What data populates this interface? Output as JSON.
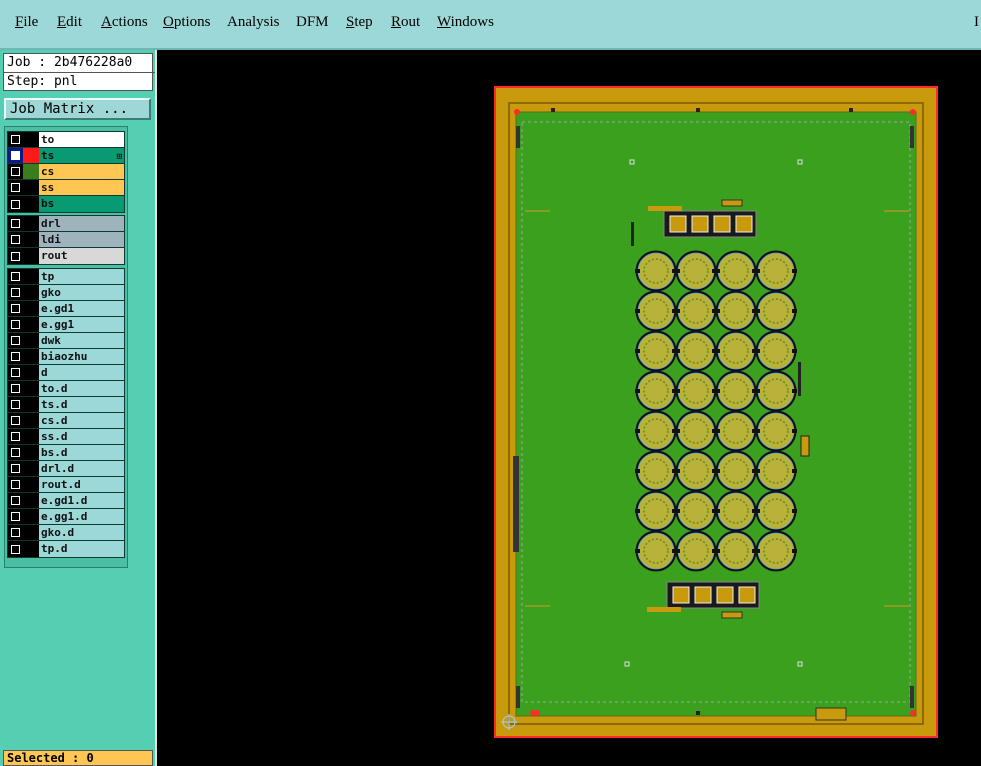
{
  "menubar": {
    "items": [
      {
        "label": "File",
        "key": "F",
        "rest": "ile"
      },
      {
        "label": "Edit",
        "key": "E",
        "rest": "dit"
      },
      {
        "label": "Actions",
        "key": "A",
        "rest": "ctions"
      },
      {
        "label": "Options",
        "key": "O",
        "rest": "ptions"
      },
      {
        "label": "Analysis",
        "key": "",
        "rest": "Analysis"
      },
      {
        "label": "DFM",
        "key": "",
        "rest": "DFM"
      },
      {
        "label": "Step",
        "key": "S",
        "rest": "tep"
      },
      {
        "label": "Rout",
        "key": "R",
        "rest": "out"
      },
      {
        "label": "Windows",
        "key": "W",
        "rest": "indows"
      }
    ],
    "edge_mark": "I"
  },
  "info": {
    "job": "Job : 2b476228a0",
    "step": "Step: pnl"
  },
  "job_matrix_button": "Job Matrix ...",
  "layers": {
    "board": [
      {
        "name": "to",
        "checked": false,
        "color": "#ffffff",
        "sel": "#000000"
      },
      {
        "name": "ts",
        "checked": true,
        "color": "#0a9a72",
        "sel": "#ff1a1a",
        "active": true
      },
      {
        "name": "cs",
        "checked": false,
        "color": "#ffc653",
        "sel": "#3a7d1e"
      },
      {
        "name": "ss",
        "checked": false,
        "color": "#ffc653",
        "sel": "#000000"
      },
      {
        "name": "bs",
        "checked": false,
        "color": "#0a9a72",
        "sel": "#000000"
      }
    ],
    "drill": [
      {
        "name": "drl",
        "checked": false,
        "color": "#9fb3bd",
        "sel": "#000000"
      },
      {
        "name": "ldi",
        "checked": false,
        "color": "#9fb3bd",
        "sel": "#000000"
      },
      {
        "name": "rout",
        "checked": false,
        "color": "#d8d8d8",
        "sel": "#000000"
      }
    ],
    "misc": [
      {
        "name": "tp",
        "checked": false,
        "color": "#9cd8d8",
        "sel": "#000000"
      },
      {
        "name": "gko",
        "checked": false,
        "color": "#9cd8d8",
        "sel": "#000000"
      },
      {
        "name": "e.gd1",
        "checked": false,
        "color": "#9cd8d8",
        "sel": "#000000"
      },
      {
        "name": "e.gg1",
        "checked": false,
        "color": "#9cd8d8",
        "sel": "#000000"
      },
      {
        "name": "dwk",
        "checked": false,
        "color": "#9cd8d8",
        "sel": "#000000"
      },
      {
        "name": "biaozhu",
        "checked": false,
        "color": "#9cd8d8",
        "sel": "#000000"
      },
      {
        "name": "d",
        "checked": false,
        "color": "#9cd8d8",
        "sel": "#000000"
      },
      {
        "name": "to.d",
        "checked": false,
        "color": "#9cd8d8",
        "sel": "#000000"
      },
      {
        "name": "ts.d",
        "checked": false,
        "color": "#9cd8d8",
        "sel": "#000000"
      },
      {
        "name": "cs.d",
        "checked": false,
        "color": "#9cd8d8",
        "sel": "#000000"
      },
      {
        "name": "ss.d",
        "checked": false,
        "color": "#9cd8d8",
        "sel": "#000000"
      },
      {
        "name": "bs.d",
        "checked": false,
        "color": "#9cd8d8",
        "sel": "#000000"
      },
      {
        "name": "drl.d",
        "checked": false,
        "color": "#9cd8d8",
        "sel": "#000000"
      },
      {
        "name": "rout.d",
        "checked": false,
        "color": "#9cd8d8",
        "sel": "#000000"
      },
      {
        "name": "e.gd1.d",
        "checked": false,
        "color": "#9cd8d8",
        "sel": "#000000"
      },
      {
        "name": "e.gg1.d",
        "checked": false,
        "color": "#9cd8d8",
        "sel": "#000000"
      },
      {
        "name": "gko.d",
        "checked": false,
        "color": "#9cd8d8",
        "sel": "#000000"
      },
      {
        "name": "tp.d",
        "checked": false,
        "color": "#9cd8d8",
        "sel": "#000000"
      }
    ]
  },
  "status": {
    "selected": "Selected : 0"
  },
  "panel": {
    "frame_color": "#c89a0c",
    "board_color": "#3aa01e",
    "outline_color": "#ff2b2b",
    "pcb_rows": 8,
    "pcb_cols": 4,
    "pcb_color": "#b8b23a"
  }
}
